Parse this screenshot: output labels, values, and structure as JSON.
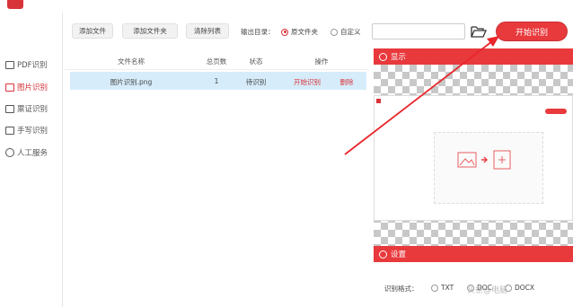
{
  "app": {
    "title": ""
  },
  "sidebar": {
    "items": [
      {
        "label": "PDF识别",
        "icon": "pdf-icon",
        "active": false
      },
      {
        "label": "图片识别",
        "icon": "image-icon",
        "active": true
      },
      {
        "label": "票证识别",
        "icon": "ticket-icon",
        "active": false
      },
      {
        "label": "手写识别",
        "icon": "handwriting-icon",
        "active": false
      },
      {
        "label": "人工服务",
        "icon": "smile-icon",
        "active": false
      }
    ]
  },
  "toolbar": {
    "add_file": "添加文件",
    "add_folder": "添加文件夹",
    "clear_list": "清除列表",
    "output_label": "输出目录：",
    "radio_original": "原文件夹",
    "radio_custom": "自定义",
    "selected_output": "原文件夹",
    "path_value": "",
    "folder_icon": "folder-open-icon",
    "start_label": "开始识别"
  },
  "table": {
    "headers": [
      "文件名称",
      "总页数",
      "状态",
      "操作"
    ],
    "rows": [
      {
        "name": "图片识别.png",
        "pages": "1",
        "status": "待识别",
        "action_start": "开始识别",
        "action_delete": "删除"
      }
    ]
  },
  "preview": {
    "header": "显示",
    "header_icon": "eye-icon"
  },
  "settings": {
    "header": "设置",
    "header_icon": "gear-icon",
    "format_label": "识别格式：",
    "formats": [
      "TXT",
      "DOC",
      "DOCX"
    ]
  },
  "watermark": "头条@电脑"
}
